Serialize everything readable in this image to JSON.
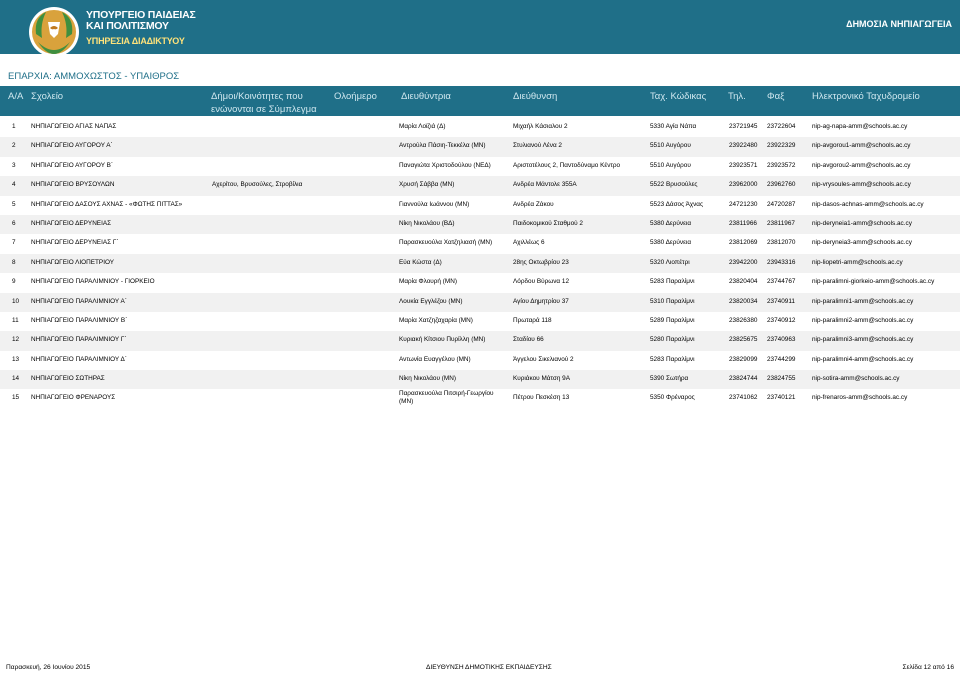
{
  "header": {
    "ministry_line1": "ΥΠΟΥΡΓΕΙΟ ΠΑΙΔΕΙΑΣ",
    "ministry_line2": "ΚΑΙ ΠΟΛΙΤΙΣΜΟΥ",
    "service": "ΥΠΗΡΕΣΙΑ ΔΙΑΔΙΚΤΥΟΥ",
    "section": "ΔΗΜΟΣΙΑ ΝΗΠΙΑΓΩΓΕΙΑ"
  },
  "district": "ΕΠΑΡΧΙΑ: ΑΜΜΟΧΩΣΤΟΣ - ΥΠΑΙΘΡΟΣ",
  "columns": {
    "aa": "Α/Α",
    "school": "Σχολείο",
    "communities": "Δήμοι/Κοινότητες που ενώνονται σε Σύμπλεγμα",
    "full_name": "Ολοήμερο",
    "director": "Διευθύντρια",
    "address": "Διεύθυνση",
    "postcode": "Ταχ. Κώδικας",
    "phone": "Τηλ.",
    "fax": "Φαξ",
    "email": "Ηλεκτρονικό Ταχυδρομείο"
  },
  "rows": [
    {
      "aa": "1",
      "school": "ΝΗΠΙΑΓΩΓΕΙΟ ΑΓΙΑΣ ΝΑΠΑΣ",
      "communities": "",
      "director": "Μαρία Λοϊζιά (Δ)",
      "address": "Μιχαήλ Κάσιαλου 2",
      "postcode": "5330 Αγία Νάπα",
      "phone": "23721945",
      "fax": "23722604",
      "email": "nip-ag-napa-amm@schools.ac.cy"
    },
    {
      "aa": "2",
      "school": "ΝΗΠΙΑΓΩΓΕΙΟ ΑΥΓΟΡΟΥ Α΄",
      "communities": "",
      "director": "Αντρούλα Πάσιη-Τεκκέλα (ΜΝ)",
      "address": "Στυλιανού Λένα 2",
      "postcode": "5510 Αυγόρου",
      "phone": "23922480",
      "fax": "23922329",
      "email": "nip-avgorou1-amm@schools.ac.cy"
    },
    {
      "aa": "3",
      "school": "ΝΗΠΙΑΓΩΓΕΙΟ ΑΥΓΟΡΟΥ Β΄",
      "communities": "",
      "director": "Παναγιώτα Χριστοδούλου (ΝΕΔ)",
      "address": "Αριστοτέλους 2, Παντοδύναμο Κέντρο",
      "postcode": "5510 Αυγόρου",
      "phone": "23923571",
      "fax": "23923572",
      "email": "nip-avgorou2-amm@schools.ac.cy"
    },
    {
      "aa": "4",
      "school": "ΝΗΠΙΑΓΩΓΕΙΟ ΒΡΥΣΟΥΛΩΝ",
      "communities": "Αχερίτου, Βρυσούλες, Στροβίλια",
      "director": "Χρυσή Σάββα (ΜΝ)",
      "address": "Ανδρέα Μάντολε 355Α",
      "postcode": "5522 Βρυσούλες",
      "phone": "23962000",
      "fax": "23962760",
      "email": "nip-vrysoules-amm@schools.ac.cy"
    },
    {
      "aa": "5",
      "school": "ΝΗΠΙΑΓΩΓΕΙΟ ΔΑΣΟΥΣ ΑΧΝΑΣ - «ΦΩΤΗΣ ΠΙΤΤΑΣ»",
      "communities": "",
      "director": "Γιαννούλα Ιωάννου (ΜΝ)",
      "address": "Ανδρέα Ζάκου",
      "postcode": "5523 Δάσος Άχνας",
      "phone": "24721230",
      "fax": "24720287",
      "email": "nip-dasos-achnas-amm@schools.ac.cy"
    },
    {
      "aa": "6",
      "school": "ΝΗΠΙΑΓΩΓΕΙΟ ΔΕΡΥΝΕΙΑΣ",
      "communities": "",
      "director": "Νίκη Νικολάου (ΒΔ)",
      "address": "Παιδοκομικού Σταθμού 2",
      "postcode": "5380 Δερύνεια",
      "phone": "23811966",
      "fax": "23811967",
      "email": "nip-deryneia1-amm@schools.ac.cy"
    },
    {
      "aa": "7",
      "school": "ΝΗΠΙΑΓΩΓΕΙΟ ΔΕΡΥΝΕΙΑΣ Γ΄",
      "communities": "",
      "director": "Παρασκευούλα Χατζηλιασή (ΜΝ)",
      "address": "Αχιλλέως 6",
      "postcode": "5380 Δερύνεια",
      "phone": "23812069",
      "fax": "23812070",
      "email": "nip-deryneia3-amm@schools.ac.cy"
    },
    {
      "aa": "8",
      "school": "ΝΗΠΙΑΓΩΓΕΙΟ ΛΙΟΠΕΤΡΙΟΥ",
      "communities": "",
      "director": "Εύα Κώστα (Δ)",
      "address": "28ης Οκτωβρίου 23",
      "postcode": "5320 Λιοπέτρι",
      "phone": "23942200",
      "fax": "23943316",
      "email": "nip-liopetri-amm@schools.ac.cy"
    },
    {
      "aa": "9",
      "school": "ΝΗΠΙΑΓΩΓΕΙΟ ΠΑΡΑΛΙΜΝΙΟΥ - ΓΙΟΡΚΕΙΟ",
      "communities": "",
      "director": "Μαρία Φλουρή (ΜΝ)",
      "address": "Λόρδου Βύρωνα 12",
      "postcode": "5283 Παραλίμνι",
      "phone": "23820404",
      "fax": "23744767",
      "email": "nip-paralimni-giorkeio-amm@schools.ac.cy"
    },
    {
      "aa": "10",
      "school": "ΝΗΠΙΑΓΩΓΕΙΟ ΠΑΡΑΛΙΜΝΙΟΥ Α΄",
      "communities": "",
      "director": "Λουκία Εγγλέζου (ΜΝ)",
      "address": "Αγίου Δημητρίου 37",
      "postcode": "5310 Παραλίμνι",
      "phone": "23820034",
      "fax": "23740911",
      "email": "nip-paralimni1-amm@schools.ac.cy"
    },
    {
      "aa": "11",
      "school": "ΝΗΠΙΑΓΩΓΕΙΟ ΠΑΡΑΛΙΜΝΙΟΥ Β΄",
      "communities": "",
      "director": "Μαρία Χατζηζαχαρία (ΜΝ)",
      "address": "Πρωταρά 118",
      "postcode": "5289 Παραλίμνι",
      "phone": "23826380",
      "fax": "23740912",
      "email": "nip-paralimni2-amm@schools.ac.cy"
    },
    {
      "aa": "12",
      "school": "ΝΗΠΙΑΓΩΓΕΙΟ ΠΑΡΑΛΙΜΝΙΟΥ Γ΄",
      "communities": "",
      "director": "Κυριακή Κίτσιου Πυρίλλη (ΜΝ)",
      "address": "Σταδίου 66",
      "postcode": "5280 Παραλίμνι",
      "phone": "23825675",
      "fax": "23740963",
      "email": "nip-paralimni3-amm@schools.ac.cy"
    },
    {
      "aa": "13",
      "school": "ΝΗΠΙΑΓΩΓΕΙΟ ΠΑΡΑΛΙΜΝΙΟΥ Δ΄",
      "communities": "",
      "director": "Αντωνία Ευαγγέλου (ΜΝ)",
      "address": "Άγγελου Σικελιανού 2",
      "postcode": "5283 Παραλίμνι",
      "phone": "23829099",
      "fax": "23744299",
      "email": "nip-paralimni4-amm@schools.ac.cy"
    },
    {
      "aa": "14",
      "school": "ΝΗΠΙΑΓΩΓΕΙΟ ΣΩΤΗΡΑΣ",
      "communities": "",
      "director": "Νίκη Νικολάου (ΜΝ)",
      "address": "Κυριάκου Μάτση 9Α",
      "postcode": "5390 Σωτήρα",
      "phone": "23824744",
      "fax": "23824755",
      "email": "nip-sotira-amm@schools.ac.cy"
    },
    {
      "aa": "15",
      "school": "ΝΗΠΙΑΓΩΓΕΙΟ ΦΡΕΝΑΡΟΥΣ",
      "communities": "",
      "director": "Παρασκευούλα Πιτσιρή-Γεωργίου (ΜΝ)",
      "address": "Πέτρου Πεσκέση 13",
      "postcode": "5350 Φρέναρος",
      "phone": "23741062",
      "fax": "23740121",
      "email": "nip-frenaros-amm@schools.ac.cy"
    }
  ],
  "footer": {
    "date": "Παρασκευή, 26 Ιουνίου 2015",
    "department": "ΔΙΕΥΘΥΝΣΗ ΔΗΜΟΤΙΚΗΣ ΕΚΠΑΙΔΕΥΣΗΣ",
    "page": "Σελίδα 12 από 16"
  }
}
